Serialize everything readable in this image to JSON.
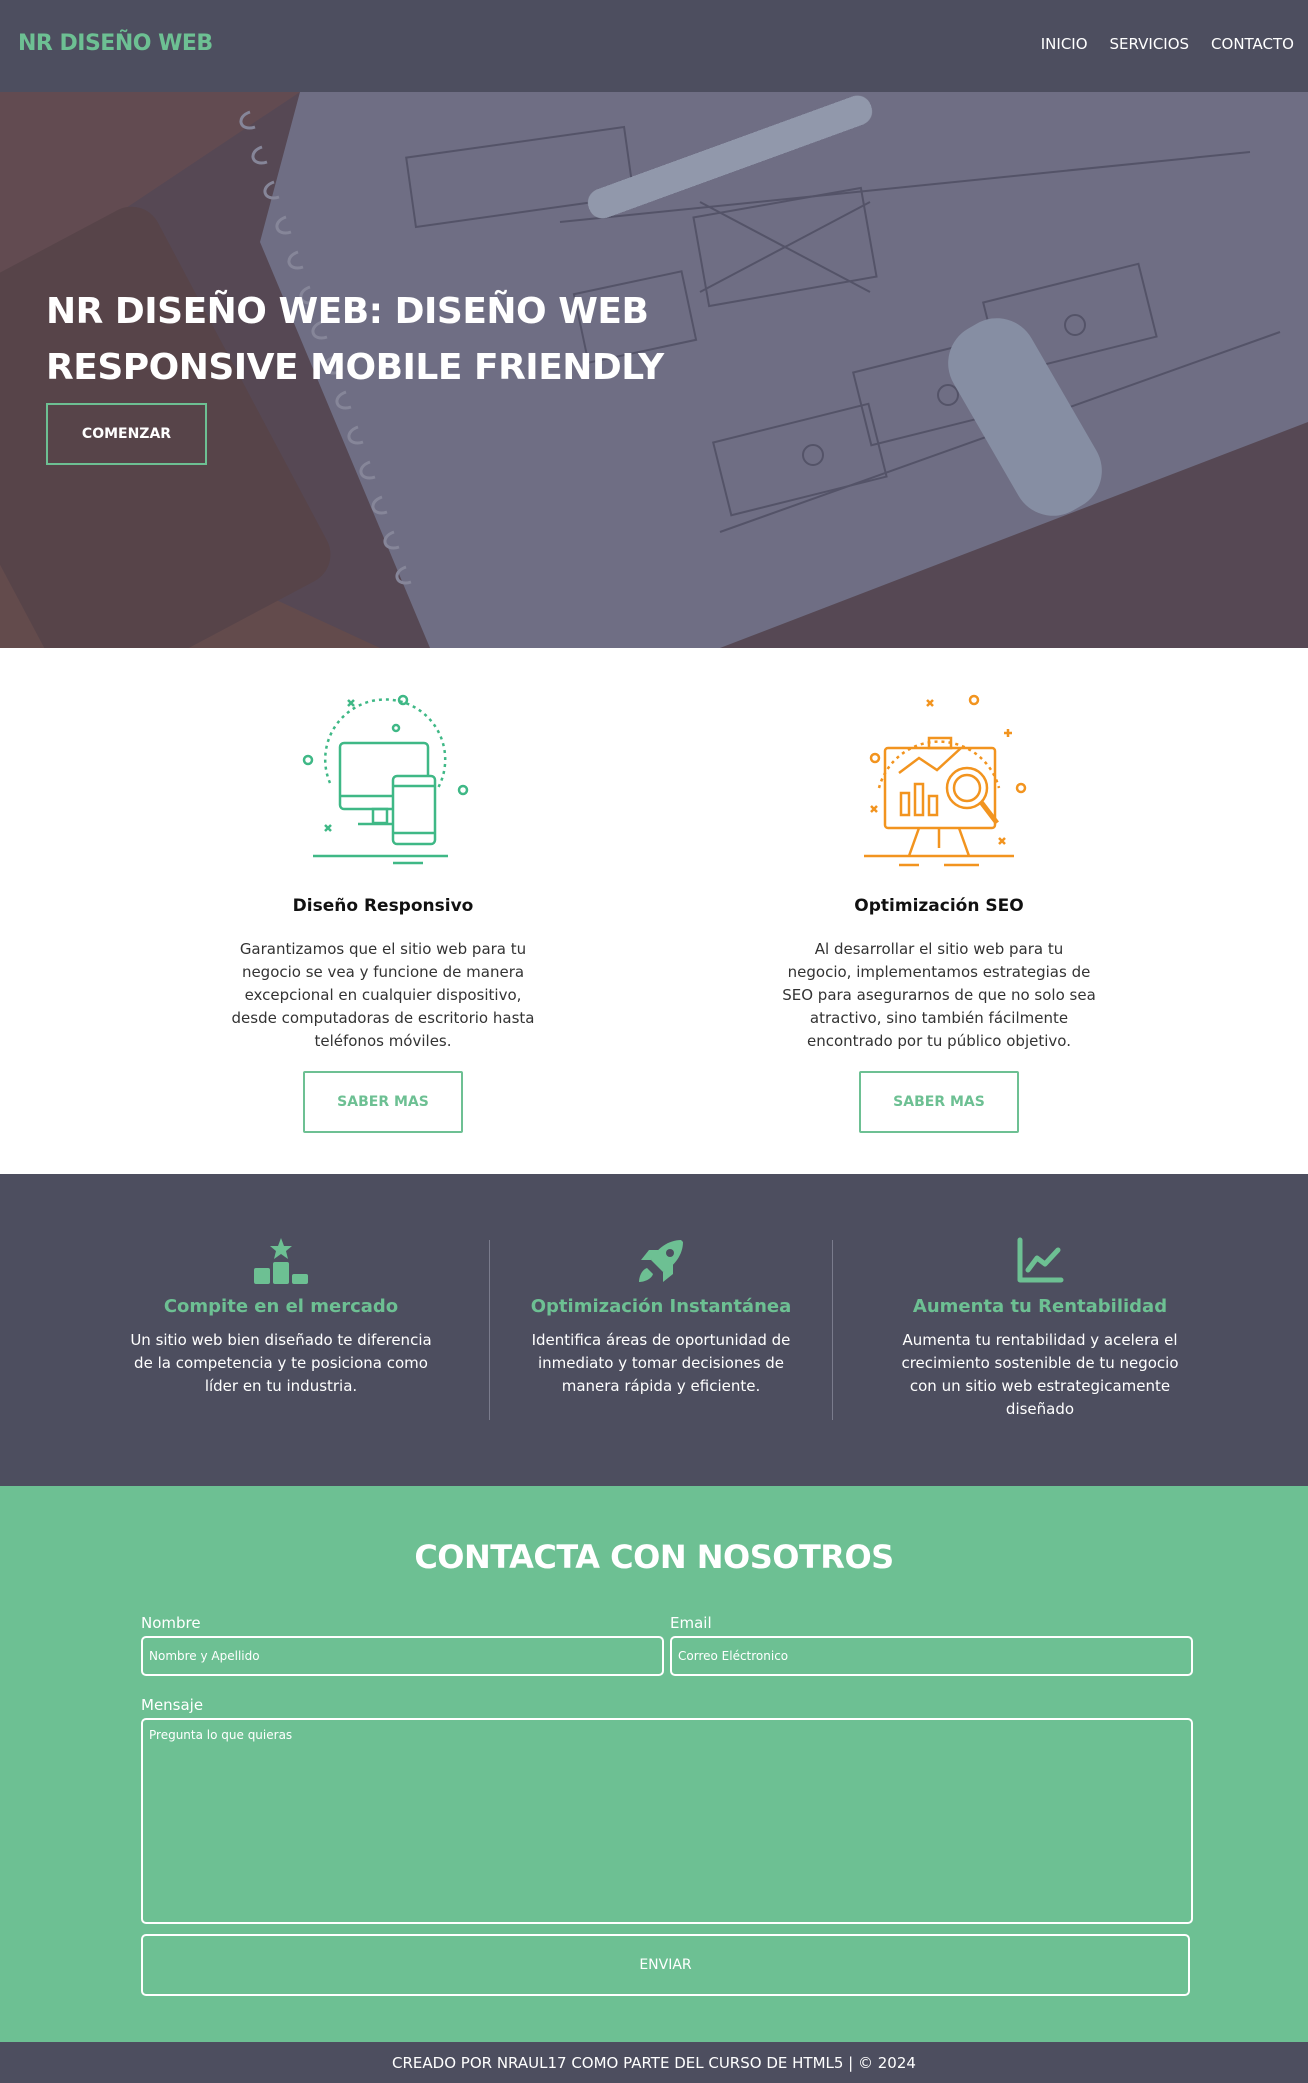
{
  "header": {
    "logo": "NR DISEÑO WEB",
    "nav": [
      "INICIO",
      "SERVICIOS",
      "CONTACTO"
    ]
  },
  "hero": {
    "title_strong": "NR DISEÑO WEB:",
    "title_rest": " DISEÑO WEB RESPONSIVE MOBILE FRIENDLY",
    "button": "COMENZAR"
  },
  "services": [
    {
      "icon": "responsive-devices-icon",
      "title": "Diseño Responsivo",
      "text": "Garantizamos que el sitio web para tu negocio se vea y funcione de manera excepcional en cualquier dispositivo, desde computadoras de escritorio hasta teléfonos móviles.",
      "button": "SABER MAS"
    },
    {
      "icon": "seo-analytics-icon",
      "title": "Optimización SEO",
      "text": "Al desarrollar el sitio web para tu negocio, implementamos estrategias de SEO para asegurarnos de que no solo sea atractivo, sino también fácilmente encontrado por tu público objetivo.",
      "button": "SABER MAS"
    }
  ],
  "features": [
    {
      "icon": "podium-icon",
      "title": "Compite en el mercado",
      "text": "Un sitio web bien diseñado te diferencia de la competencia y te posiciona como líder en tu industria."
    },
    {
      "icon": "rocket-icon",
      "title": "Optimización Instantánea",
      "text": "Identifica áreas de oportunidad de inmediato y tomar decisiones de manera rápida y eficiente."
    },
    {
      "icon": "chart-line-icon",
      "title": "Aumenta tu Rentabilidad",
      "text": "Aumenta tu rentabilidad y acelera el crecimiento sostenible de tu negocio con un sitio web estrategicamente diseñado"
    }
  ],
  "contact": {
    "title": "CONTACTA CON NOSOTROS",
    "name_label": "Nombre",
    "name_placeholder": "Nombre y Apellido",
    "email_label": "Email",
    "email_placeholder": "Correo Eléctronico",
    "message_label": "Mensaje",
    "message_placeholder": "Pregunta lo que quieras",
    "submit": "ENVIAR"
  },
  "footer": {
    "text": "CREADO POR NRAUL17 COMO PARTE DEL CURSO DE HTML5 | © 2024"
  },
  "colors": {
    "accent": "#6dc093",
    "dark": "#4d4e5f",
    "seo_orange": "#f2941f"
  }
}
